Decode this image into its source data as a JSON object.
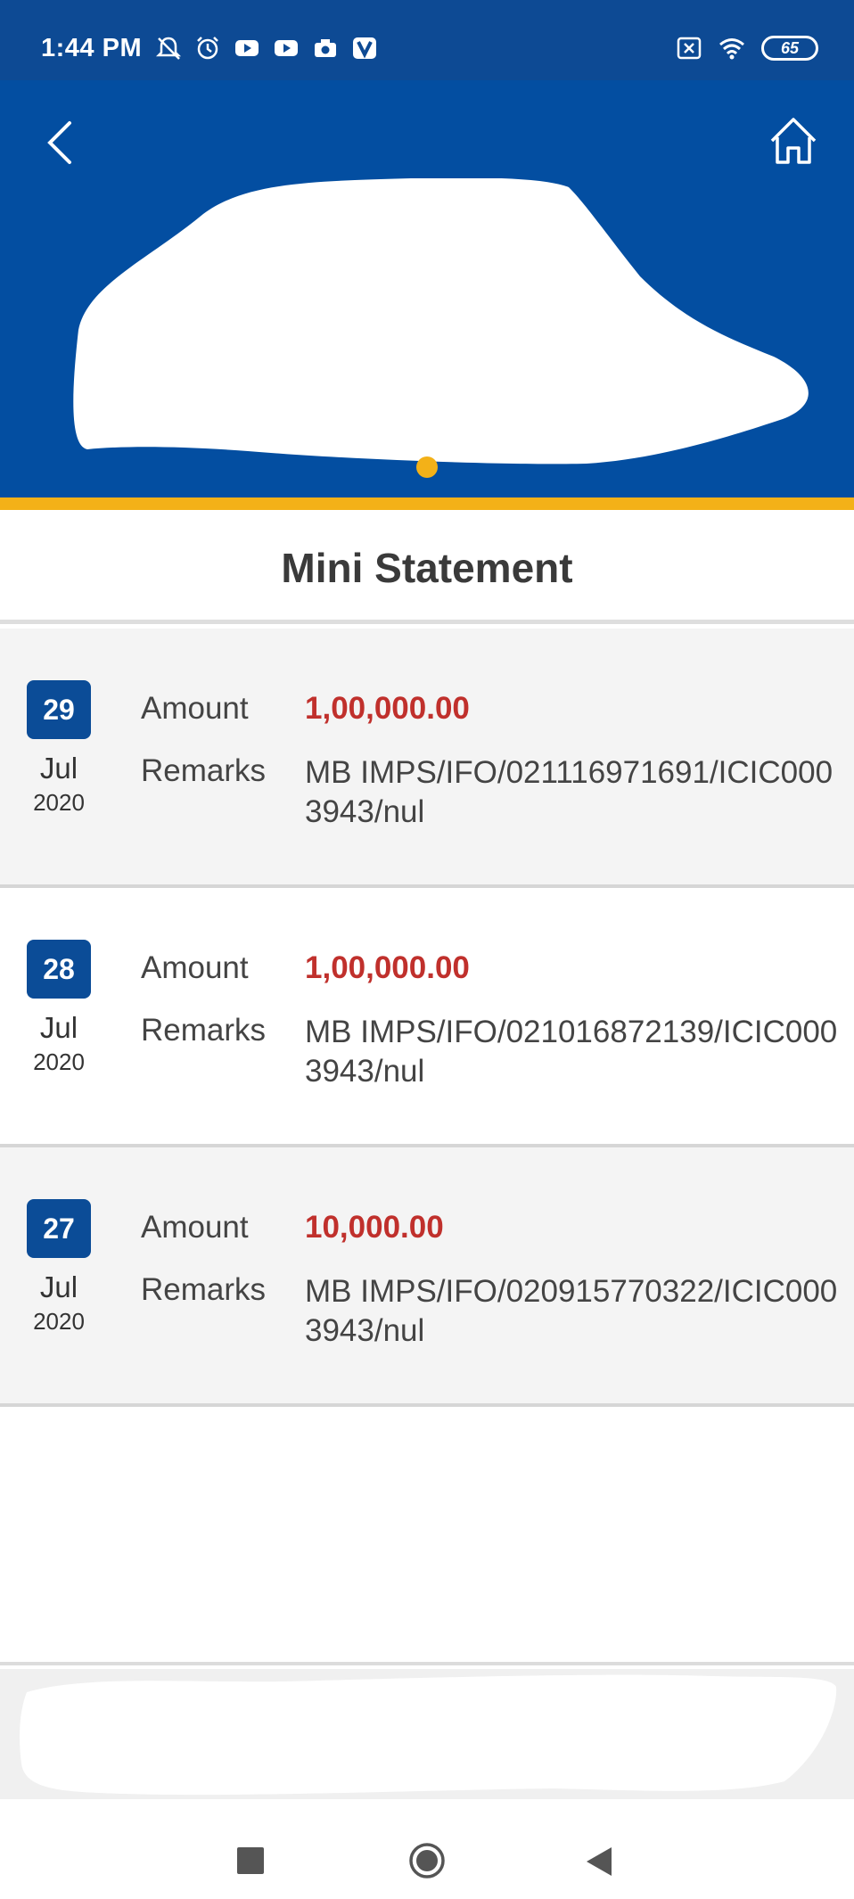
{
  "status_bar": {
    "time": "1:44 PM",
    "battery": "65",
    "icons": [
      "notifications-muted-icon",
      "alarm-icon",
      "youtube-icon",
      "youtube-icon",
      "camera-icon",
      "vpn-v-icon",
      "sim-off-icon",
      "wifi-icon"
    ]
  },
  "header": {
    "back_icon": "chevron-left-icon",
    "home_icon": "home-icon"
  },
  "page": {
    "title": "Mini Statement"
  },
  "labels": {
    "amount": "Amount",
    "remarks": "Remarks"
  },
  "transactions": [
    {
      "day": "29",
      "month": "Jul",
      "year": "2020",
      "amount": "1,00,000.00",
      "remarks": "MB IMPS/IFO/021116971691/ICIC0003943/nul"
    },
    {
      "day": "28",
      "month": "Jul",
      "year": "2020",
      "amount": "1,00,000.00",
      "remarks": "MB IMPS/IFO/021016872139/ICIC0003943/nul"
    },
    {
      "day": "27",
      "month": "Jul",
      "year": "2020",
      "amount": "10,000.00",
      "remarks": "MB IMPS/IFO/020915770322/ICIC0003943/nul"
    }
  ],
  "colors": {
    "header_blue": "#034ea1",
    "accent_yellow": "#f3b118",
    "amount_red": "#c0302c",
    "badge_blue": "#0b4c97"
  },
  "nav_bar": {
    "icons": [
      "recent-apps-icon",
      "home-circle-icon",
      "back-triangle-icon"
    ]
  }
}
